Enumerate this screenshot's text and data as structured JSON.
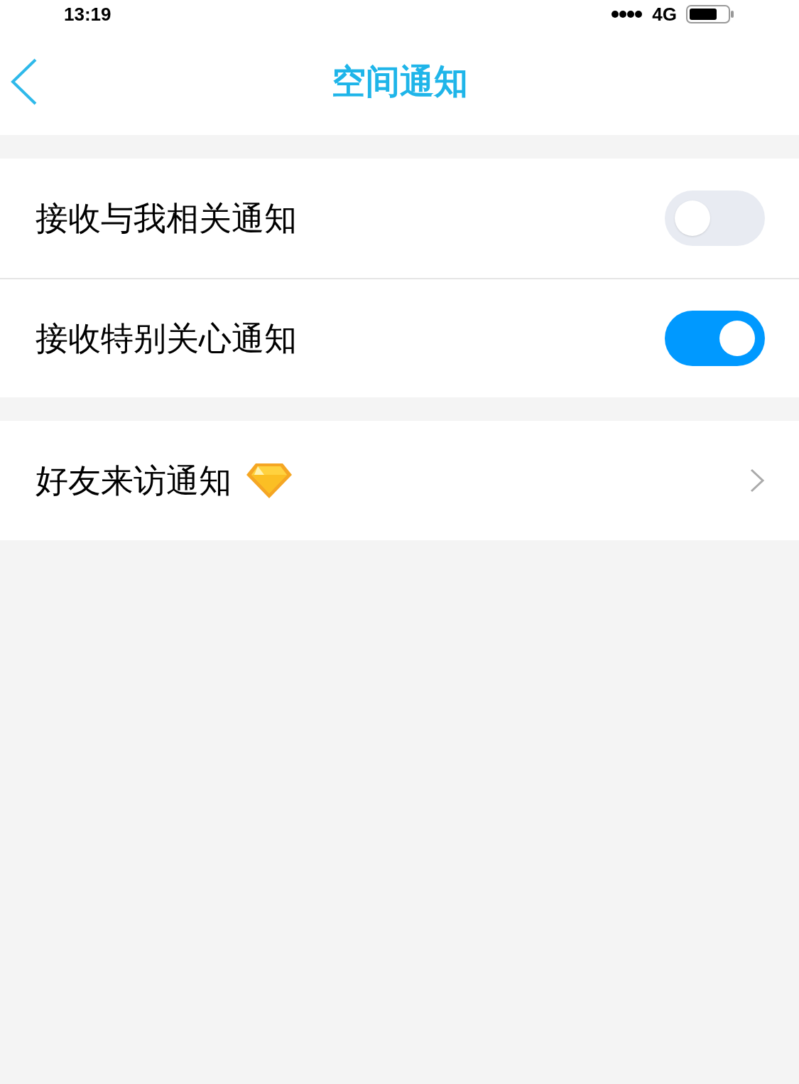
{
  "status_bar": {
    "time": "13:19",
    "network": "4G"
  },
  "nav": {
    "title": "空间通知"
  },
  "groups": [
    {
      "rows": [
        {
          "kind": "toggle",
          "label": "接收与我相关通知",
          "on": false
        },
        {
          "kind": "toggle",
          "label": "接收特别关心通知",
          "on": true
        }
      ]
    },
    {
      "rows": [
        {
          "kind": "link",
          "label": "好友来访通知",
          "badge": true
        }
      ]
    }
  ]
}
